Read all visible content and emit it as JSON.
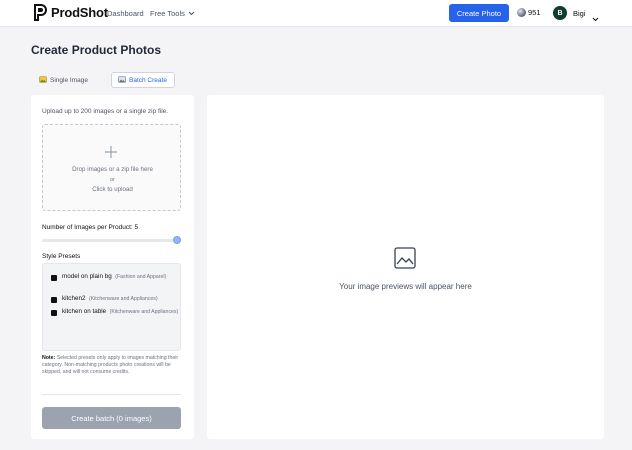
{
  "header": {
    "brand": "ProdShot",
    "nav": [
      {
        "label": "Dashboard"
      },
      {
        "label": "Free Tools"
      }
    ],
    "create_button": "Create Photo",
    "credits": "951",
    "avatar_initial": "B",
    "username": "Bigi"
  },
  "colors": {
    "accent": "#2563eb",
    "avatar": "#0f3d2e",
    "disabled_button": "#9ca3af"
  },
  "main": {
    "title": "Create Product Photos",
    "tabs": [
      {
        "label": "Single Image",
        "icon": "image-emoji-icon",
        "active": false
      },
      {
        "label": "Batch Create",
        "icon": "images-icon",
        "active": true
      }
    ]
  },
  "upload": {
    "hint": "Upload up to 200 images or a single zip file.",
    "drop_text": "Drop images or a zip file here",
    "or_text": "or",
    "click_text": "Click to upload"
  },
  "images_per_product": {
    "label": "Number of Images per Product: 5",
    "value": 5,
    "fraction": 1.0
  },
  "style_presets": {
    "label": "Style Presets",
    "items": [
      {
        "name": "model on plain bg",
        "category": "(Fashion and Apparel)"
      },
      {
        "name": "kitchen2",
        "category": "(Kitchenware and Appliances)"
      },
      {
        "name": "kitchen on table",
        "category": "(Kitchenware and Appliances)"
      }
    ]
  },
  "note": {
    "label": "Note:",
    "text": "Selected presets only apply to images matching their category. Non-matching products photo creations will be skipped, and will not consume credits."
  },
  "batch_button": "Create batch (0 images)",
  "preview": {
    "placeholder": "Your image previews will appear here",
    "icon": "image-placeholder-icon"
  }
}
